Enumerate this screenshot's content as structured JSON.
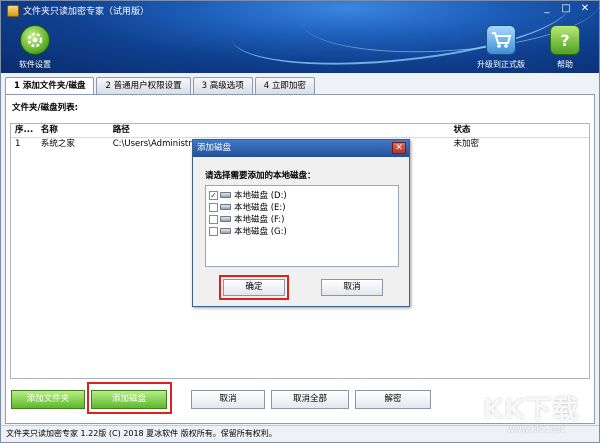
{
  "window": {
    "title": "文件夹只读加密专家（试用版）",
    "controls": [
      "_",
      "□",
      "✕"
    ]
  },
  "toolbar": {
    "settings_label": "软件设置",
    "upgrade_label": "升级到正式版",
    "help_label": "帮助"
  },
  "tabs": [
    {
      "label": "1 添加文件夹/磁盘"
    },
    {
      "label": "2 普通用户权限设置"
    },
    {
      "label": "3 高级选项"
    },
    {
      "label": "4 立即加密"
    }
  ],
  "list_label": "文件夹/磁盘列表:",
  "table": {
    "headers": [
      "序...",
      "名称",
      "路径",
      "状态"
    ],
    "rows": [
      {
        "idx": "1",
        "name": "系统之家",
        "path": "C:\\Users\\Administra",
        "status": "未加密"
      }
    ]
  },
  "buttons": {
    "add_folder": "添加文件夹",
    "add_disk": "添加磁盘",
    "cancel": "取消",
    "cancel_all": "取消全部",
    "encrypt": "解密"
  },
  "status_text": "文件夹只读加密专家 1.22版 (C) 2018 夏冰软件 版权所有。保留所有权利。",
  "dialog": {
    "title": "添加磁盘",
    "prompt": "请选择需要添加的本地磁盘：",
    "drives": [
      {
        "label": "本地磁盘 (D:)",
        "checked": true
      },
      {
        "label": "本地磁盘 (E:)",
        "checked": false
      },
      {
        "label": "本地磁盘 (F:)",
        "checked": false
      },
      {
        "label": "本地磁盘 (G:)",
        "checked": false
      }
    ],
    "ok_label": "确定",
    "cancel_label": "取消",
    "close": "✕"
  },
  "watermark": {
    "big": "KK下载",
    "small": "www.kkx.net"
  },
  "colors": {
    "banner": "#1e5fba",
    "highlight": "#e0201c",
    "green_button": "#5db72b"
  },
  "icons": {
    "settings": "gear-icon",
    "upgrade": "cart-icon",
    "help": "help-icon"
  }
}
